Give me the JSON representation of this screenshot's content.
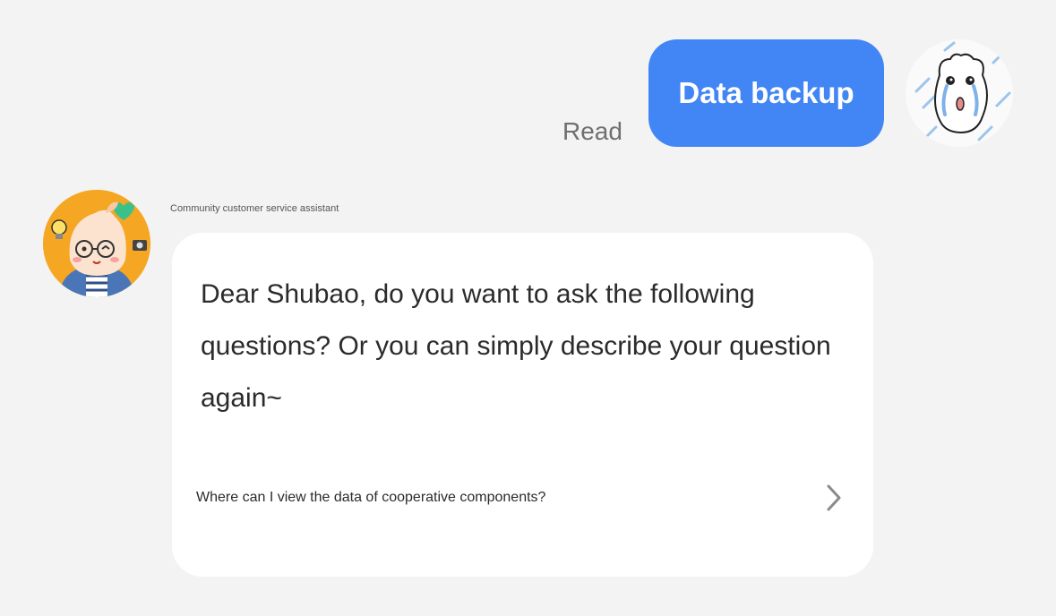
{
  "outgoing": {
    "status": "Read",
    "message": "Data backup",
    "bubble_color": "#4285f4",
    "avatar_icon": "crying-blob-avatar-icon"
  },
  "incoming": {
    "sender": "Community customer service assistant",
    "avatar_icon": "cartoon-girl-avatar-icon",
    "message": "Dear Shubao, do you want to ask the following questions? Or you can simply describe your question again~",
    "suggested_questions": [
      {
        "label": "Where can I view the data of cooperative components?",
        "icon": "chevron-right-icon"
      }
    ]
  }
}
